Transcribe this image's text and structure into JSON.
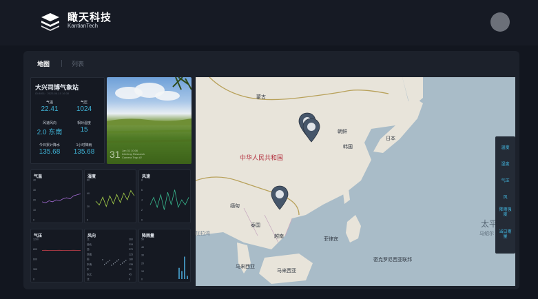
{
  "header": {
    "brand_cn": "瞰天科技",
    "brand_en": "KantianTech"
  },
  "tabs": {
    "map": "地图",
    "list": "列表"
  },
  "station": {
    "title": "大兴司博气象站",
    "subtitle": "ID:8051 · 2023-06-10 16:38",
    "temperature_label": "气温",
    "temperature_value": "22.41",
    "pressure_label": "气压",
    "pressure_value": "1024",
    "wind_label": "风速风向",
    "wind_value": "2.0 东南",
    "humidity_label": "相对湿度",
    "humidity_value": "15",
    "rain_day_label": "今日累计降水",
    "rain_day_value": "135.68",
    "rain_hour_label": "1小时降雨",
    "rain_hour_value": "135.68"
  },
  "photo": {
    "day": "31",
    "note_line1": "Jan 31 10:06",
    "note_line2": "Intertrop Research",
    "note_line3": "Camera Trap #2"
  },
  "charts": [
    {
      "title": "气温",
      "color": "#a56bd6",
      "ticks": [
        "40",
        "30",
        "20",
        "10",
        "0"
      ],
      "values": [
        18,
        17,
        19,
        18,
        20,
        19,
        21,
        22,
        21,
        24,
        25,
        26
      ]
    },
    {
      "title": "湿度",
      "color": "#a8d34a",
      "ticks": [
        "60",
        "40",
        "20",
        "0"
      ],
      "values": [
        28,
        22,
        34,
        20,
        36,
        24,
        38,
        26,
        40,
        30,
        44,
        36
      ]
    },
    {
      "title": "风速",
      "color": "#38b98f",
      "ticks": [
        "8",
        "6",
        "4",
        "2",
        "0"
      ],
      "values": [
        3,
        4.5,
        2.5,
        5,
        2,
        5.5,
        3,
        6,
        2.5,
        4,
        3,
        4.5
      ]
    },
    {
      "title": "气压",
      "color": "#d0424e",
      "ticks": [
        "1200",
        "800",
        "600",
        "300",
        "0"
      ],
      "values": [
        860,
        862,
        858,
        861,
        860,
        862,
        859,
        861,
        860,
        862,
        860,
        861
      ]
    },
    {
      "title": "风向",
      "color": "#7d8896",
      "ticks": [
        "北",
        "西北",
        "西",
        "西南",
        "南",
        "东南",
        "东",
        "东北",
        "北"
      ],
      "right_ticks": [
        "360",
        "315",
        "270",
        "225",
        "180",
        "135",
        "90",
        "45",
        "0"
      ]
    },
    {
      "title": "降雨量",
      "color": "#4aa7d6",
      "ticks": [
        "50",
        "40",
        "30",
        "20",
        "10",
        "0"
      ],
      "values": [
        0,
        0,
        0,
        0,
        0,
        0,
        0,
        0,
        0,
        0,
        14,
        10,
        28,
        4
      ]
    }
  ],
  "map": {
    "labels": {
      "mongolia": "蒙古",
      "china": "中华人民共和国",
      "north_korea": "朝鲜",
      "south_korea": "韩国",
      "japan": "日本",
      "myanmar": "缅甸",
      "thailand": "泰国",
      "vietnam": "越南",
      "philippines": "菲律宾",
      "malaysia_w": "马来西亚",
      "malaysia_e": "马来西亚",
      "micronesia": "密克罗尼西亚联邦",
      "bay": "加拉湾",
      "pacific": "太平",
      "pacific2": "马绍尔"
    }
  },
  "layers": [
    "温度",
    "湿度",
    "气压",
    "风",
    "降雨强度",
    "当日雨量"
  ],
  "colors": {
    "accent": "#3fb3d6",
    "layer_text": "#43b9e3",
    "marker": "#4a5868"
  }
}
